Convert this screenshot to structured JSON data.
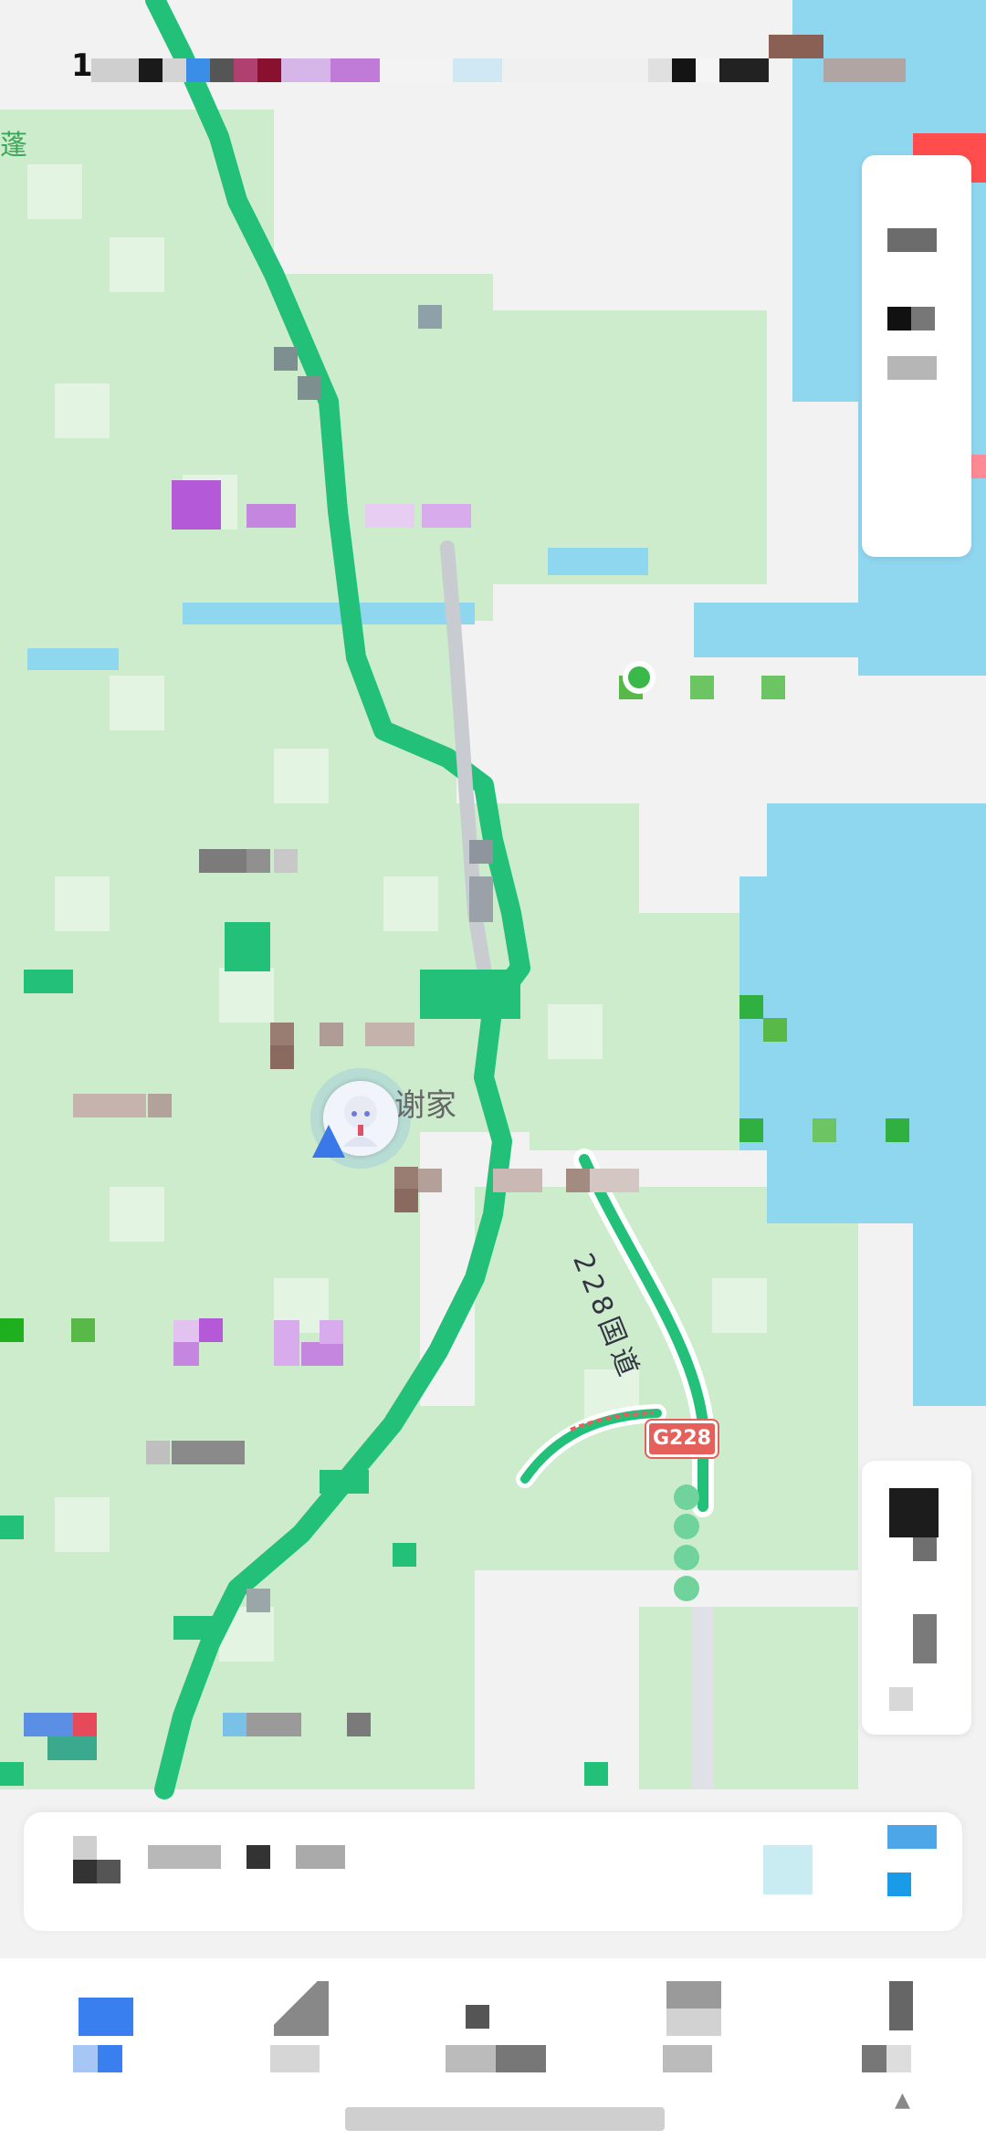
{
  "status_bar": {
    "time": "1"
  },
  "map": {
    "place_label": "谢家",
    "road_name": "228国道",
    "road_shield": "G228",
    "edge_label": "蓬"
  },
  "colors": {
    "water": "#8fd6ef",
    "park": "#c9ecc8",
    "land": "#f1f2f1",
    "road_green": "#23c07a",
    "traffic_red": "#e6605b"
  },
  "search": {
    "placeholder": ""
  },
  "tabs": [
    {
      "icon": "home-icon"
    },
    {
      "icon": "nearby-icon"
    },
    {
      "icon": "message-icon"
    },
    {
      "icon": "taxi-icon"
    },
    {
      "icon": "profile-icon"
    }
  ]
}
